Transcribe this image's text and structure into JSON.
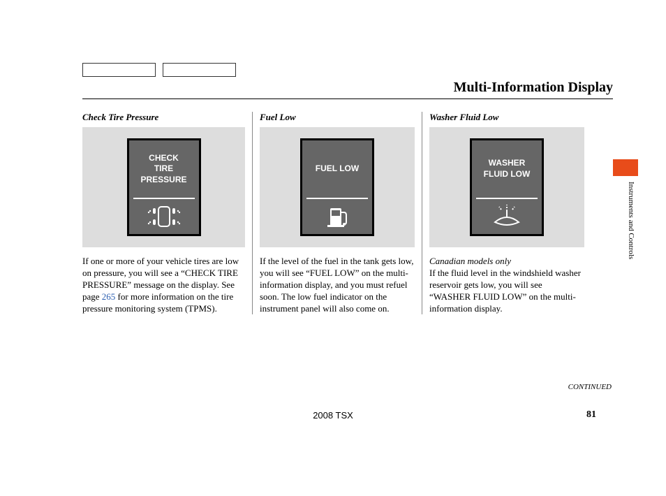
{
  "page_title": "Multi-Information Display",
  "side_label": "Instruments and Controls",
  "continued": "CONTINUED",
  "footer_model": "2008  TSX",
  "page_number": "81",
  "columns": [
    {
      "heading": "Check Tire Pressure",
      "display_text": "CHECK\nTIRE\nPRESSURE",
      "body_pre": "If one or more of your vehicle tires are low on pressure, you will see a “CHECK TIRE PRESSURE” message on the display. See page ",
      "page_ref": "265",
      "body_post": " for more information on the tire pressure monitoring system (TPMS)."
    },
    {
      "heading": "Fuel Low",
      "display_text": "FUEL LOW",
      "body": "If the level of the fuel in the tank gets low, you will see “FUEL LOW” on the multi-information display, and you must refuel soon. The low fuel indicator on the instrument panel will also come on."
    },
    {
      "heading": "Washer Fluid Low",
      "display_text": "WASHER\nFLUID LOW",
      "note": "Canadian models only",
      "body": "If the fluid level in the windshield washer reservoir gets low, you will see “WASHER FLUID LOW” on the multi-information display."
    }
  ]
}
